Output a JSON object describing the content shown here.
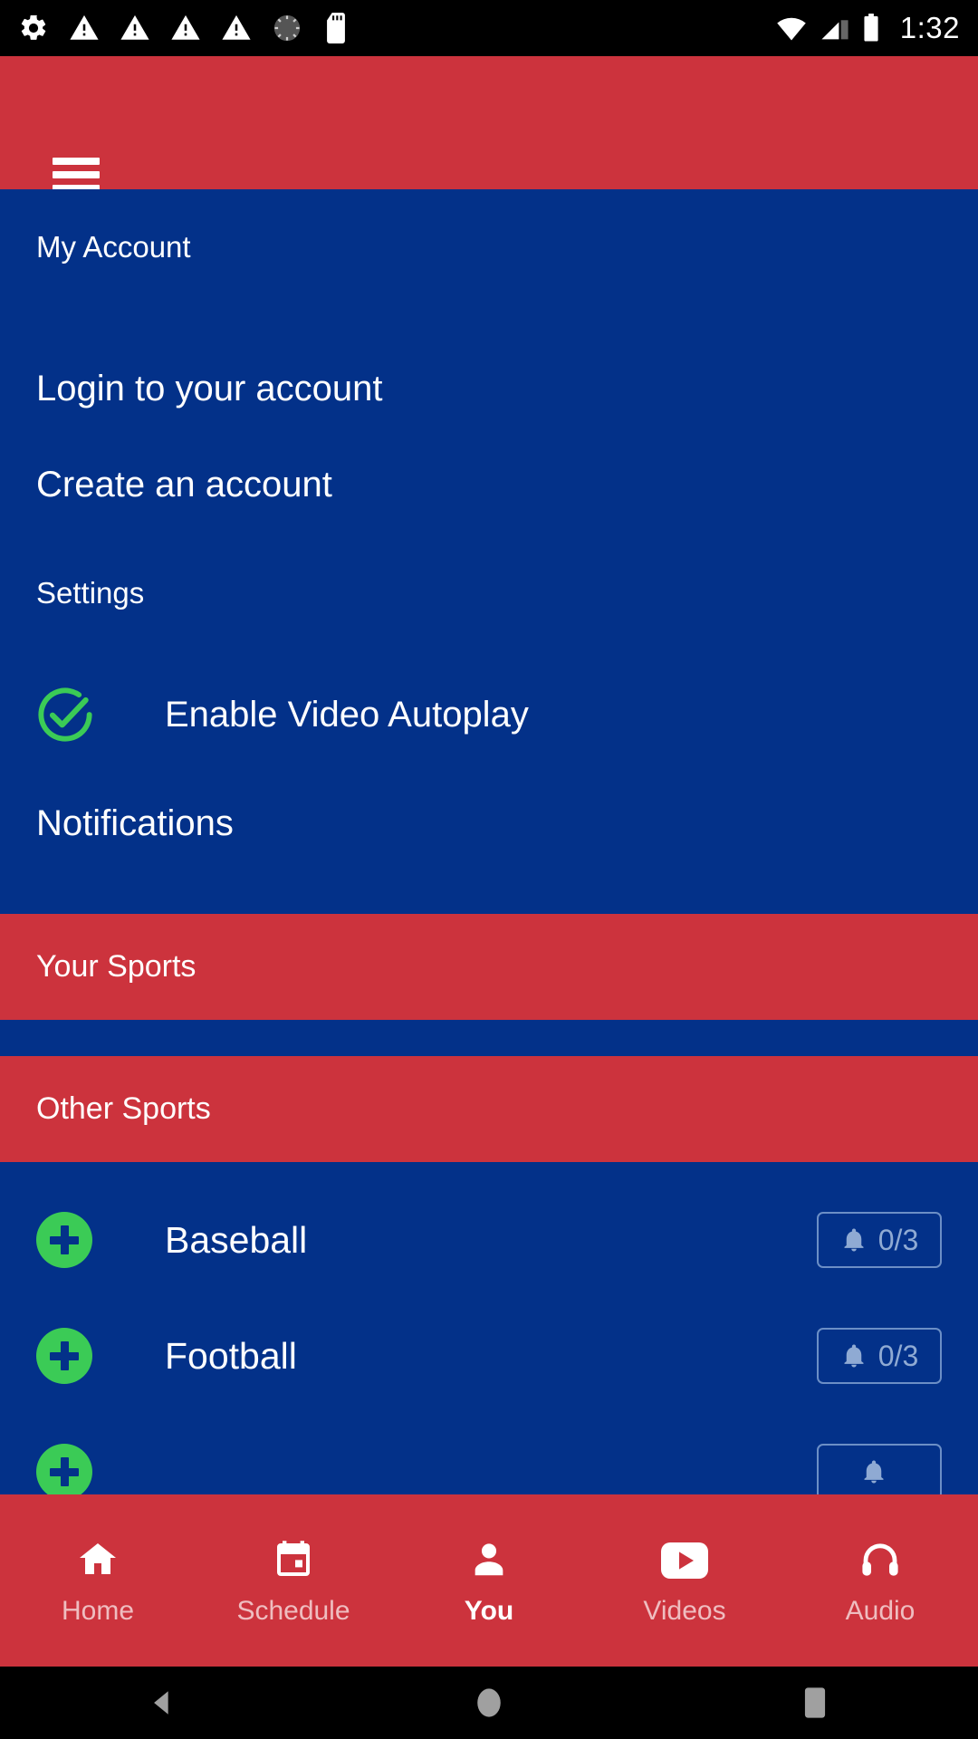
{
  "statusbar": {
    "left_icons": [
      "gear-icon",
      "warning-icon",
      "warning-icon",
      "warning-icon",
      "warning-icon",
      "loading-spinner-icon",
      "sd-card-icon"
    ],
    "right_icons": [
      "wifi-icon",
      "cellular-signal-icon",
      "battery-icon"
    ],
    "time": "1:32"
  },
  "appbar": {
    "menu_icon": "hamburger-menu-icon"
  },
  "drawer": {
    "account_header": "My Account",
    "login": "Login to your account",
    "create": "Create an account",
    "settings_header": "Settings",
    "autoplay": {
      "label": "Enable Video Autoplay",
      "checked": true,
      "icon": "check-circle-icon"
    },
    "notifications": "Notifications",
    "your_sports_header": "Your Sports",
    "other_sports_header": "Other Sports",
    "sports": [
      {
        "name": "Baseball",
        "add_icon": "plus-circle-icon",
        "bell_icon": "bell-icon",
        "count": "0/3"
      },
      {
        "name": "Football",
        "add_icon": "plus-circle-icon",
        "bell_icon": "bell-icon",
        "count": "0/3"
      },
      {
        "name": "",
        "add_icon": "plus-circle-icon",
        "bell_icon": "bell-icon",
        "count": ""
      }
    ]
  },
  "bottomnav": {
    "items": [
      {
        "label": "Home",
        "icon": "home-icon",
        "active": false
      },
      {
        "label": "Schedule",
        "icon": "calendar-icon",
        "active": false
      },
      {
        "label": "You",
        "icon": "person-icon",
        "active": true
      },
      {
        "label": "Videos",
        "icon": "video-play-icon",
        "active": false
      },
      {
        "label": "Audio",
        "icon": "headphones-icon",
        "active": false
      }
    ]
  },
  "androidnav": {
    "back": "back-triangle-icon",
    "home": "home-circle-icon",
    "recents": "recents-square-icon"
  },
  "colors": {
    "red": "#CC333D",
    "blue": "#033189",
    "green": "#3BCB56",
    "badge_text": "#8FAAD3"
  }
}
